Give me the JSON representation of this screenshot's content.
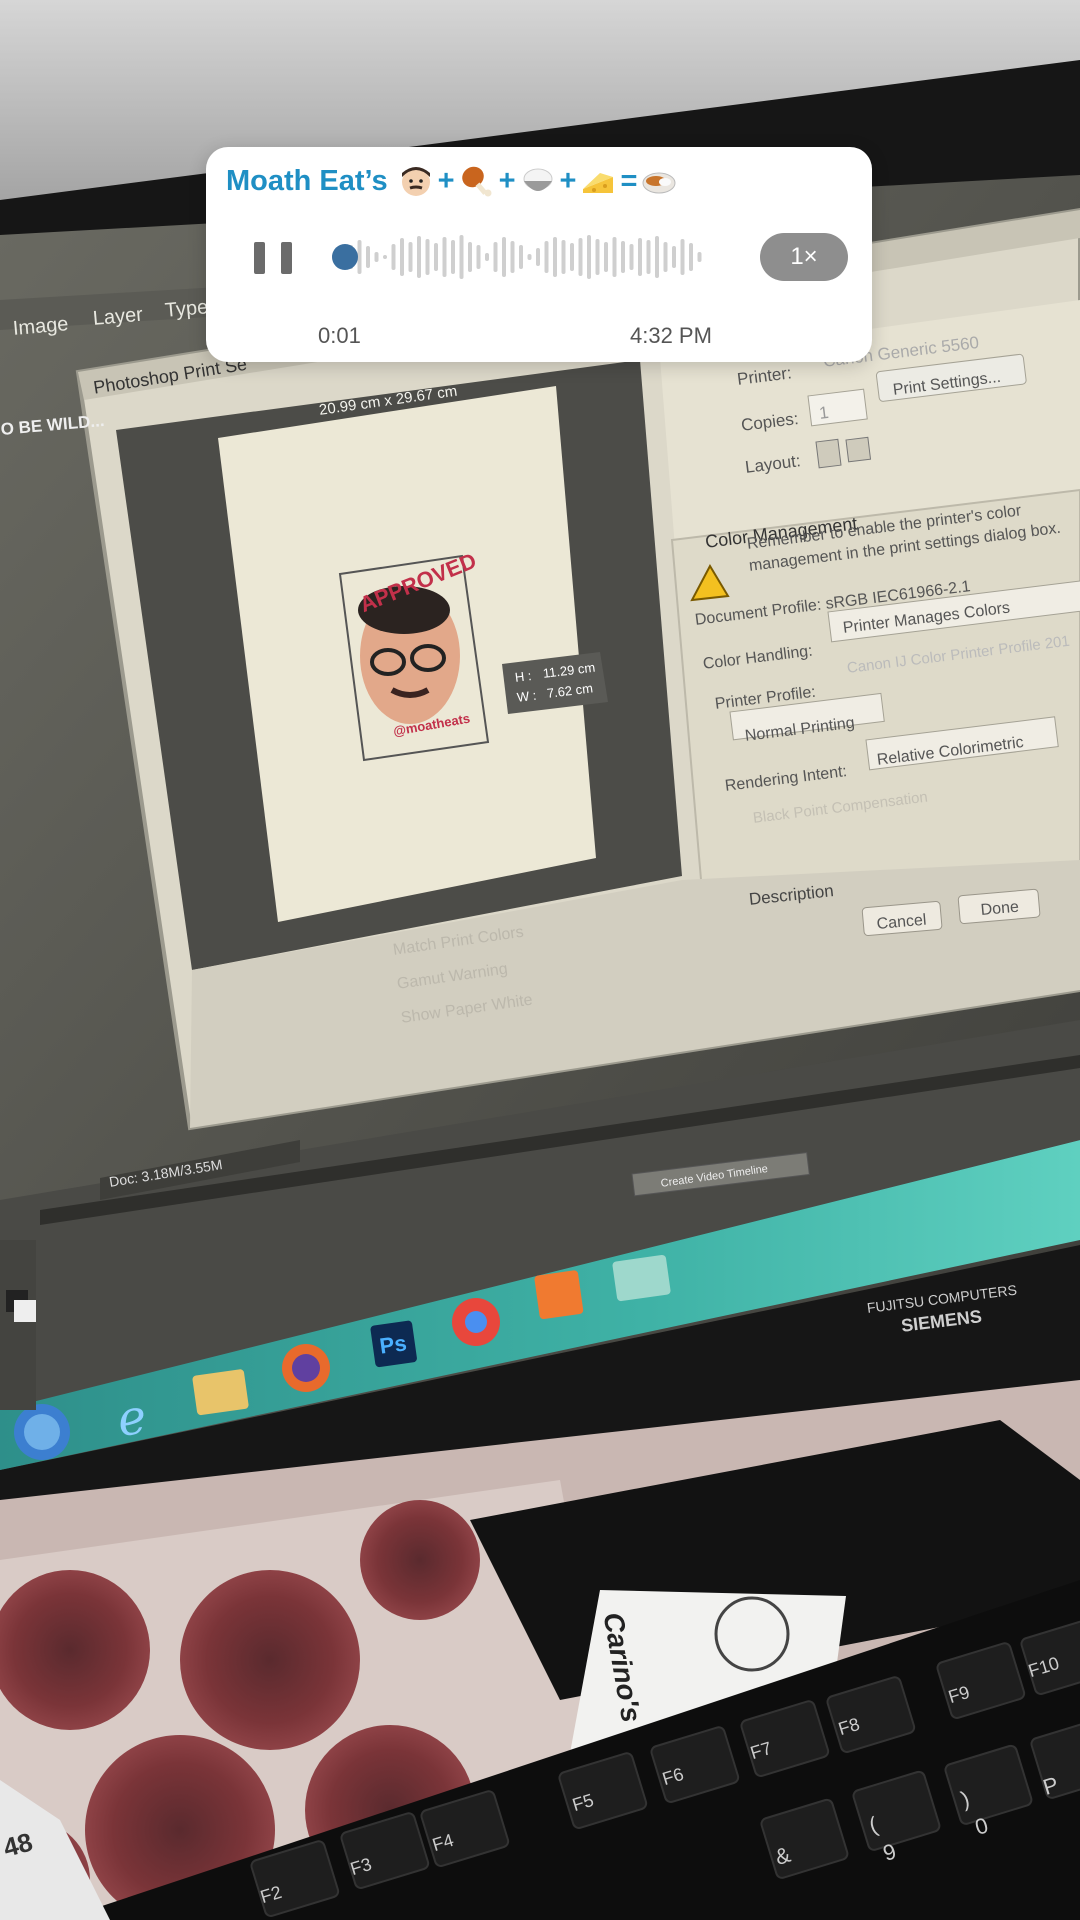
{
  "voice_message": {
    "sender_name": "Moath Eat’s",
    "emoji_formula": [
      {
        "icon": "man-face-emoji",
        "op": "+"
      },
      {
        "icon": "poultry-leg-emoji",
        "op": "+"
      },
      {
        "icon": "rice-bowl-emoji",
        "op": "+"
      },
      {
        "icon": "cheese-emoji",
        "op": "="
      },
      {
        "icon": "curry-rice-emoji",
        "op": ""
      }
    ],
    "playback_progress": 0.03,
    "speed_label": "1×",
    "elapsed": "0:01",
    "sent_time": "4:32 PM",
    "accent_color": "#1f8fc4"
  },
  "screen": {
    "menu": {
      "image": "Image",
      "layer": "Layer",
      "type": "Type"
    },
    "tab_fragment": "O BE WILD...",
    "print_dialog": {
      "title": "Photoshop Print Se",
      "paper_size": "20.99 cm x 29.67 cm",
      "sticker_top_text": "APPROVED",
      "sticker_bottom_text": "@moatheats",
      "size_h_label": "H :",
      "size_h_value": "11.29 cm",
      "size_w_label": "W :",
      "size_w_value": "7.62 cm",
      "printer_label": "Printer:",
      "printer_value": "Canon Generic 5560",
      "copies_label": "Copies:",
      "copies_value": "1",
      "print_settings_button": "Print Settings...",
      "layout_label": "Layout:",
      "color_management_heading": "Color Management",
      "warning_line1": "Remember to enable the printer's color",
      "warning_line2": "management in the print settings dialog box.",
      "document_profile": "Document Profile: sRGB IEC61966-2.1",
      "color_handling_label": "Color Handling:",
      "color_handling_value": "Printer Manages Colors",
      "printer_profile_label": "Printer Profile:",
      "printer_profile_value": "Canon IJ Color Printer Profile 201",
      "normal_printing": "Normal Printing",
      "rendering_intent_label": "Rendering Intent:",
      "rendering_intent_value": "Relative Colorimetric",
      "black_point": "Black Point Compensation",
      "description_heading": "Description",
      "cancel_button": "Cancel",
      "done_button": "Done",
      "match_print_colors": "Match Print Colors",
      "gamut_warning": "Gamut Warning",
      "show_paper_white": "Show Paper White"
    },
    "status_doc": "Doc: 3.18M/3.55M",
    "create_video_timeline": "Create Video Timeline",
    "taskbar_ps": "Ps",
    "monitor_brand_top": "FUJITSU COMPUTERS",
    "monitor_brand": "SIEMENS",
    "cup_brand": "Carino's",
    "keys": [
      "F2",
      "F3",
      "F4",
      "F5",
      "F6",
      "F7",
      "F8",
      "F9",
      "F10"
    ],
    "key_symbols": [
      "&",
      "(",
      "9",
      ")",
      "0",
      "P"
    ],
    "desk_number": "48"
  }
}
